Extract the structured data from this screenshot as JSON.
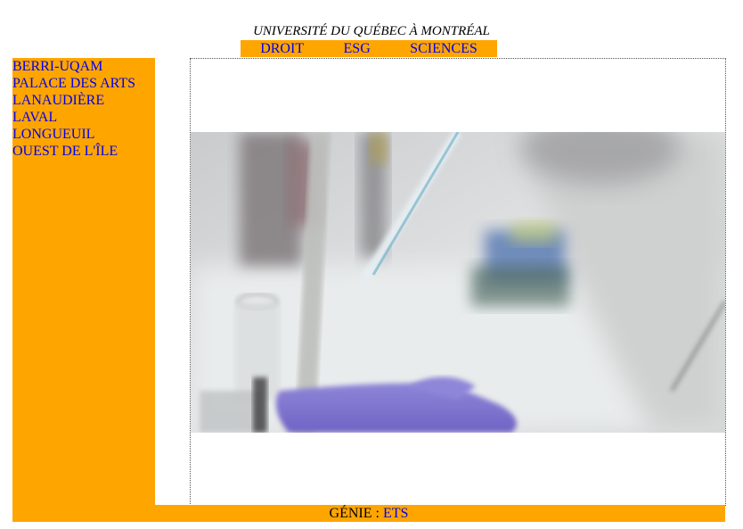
{
  "header": {
    "title": "UNIVERSITÉ DU QUÉBEC À MONTRÉAL"
  },
  "topnav": {
    "items": [
      "DROIT",
      "ESG",
      "SCIENCES"
    ]
  },
  "sidebar": {
    "items": [
      "BERRI-UQAM",
      "PALACE DES ARTS",
      "LANAUDIÈRE",
      "LAVAL",
      "LONGUEUIL",
      "OUEST DE L'ÎLE"
    ]
  },
  "main": {
    "image": {
      "subject": "laboratory-pipette-photo"
    }
  },
  "footer": {
    "label": "GÉNIE :",
    "link": "ETS"
  },
  "colors": {
    "accent": "#ffa500",
    "link": "#0000ee"
  }
}
